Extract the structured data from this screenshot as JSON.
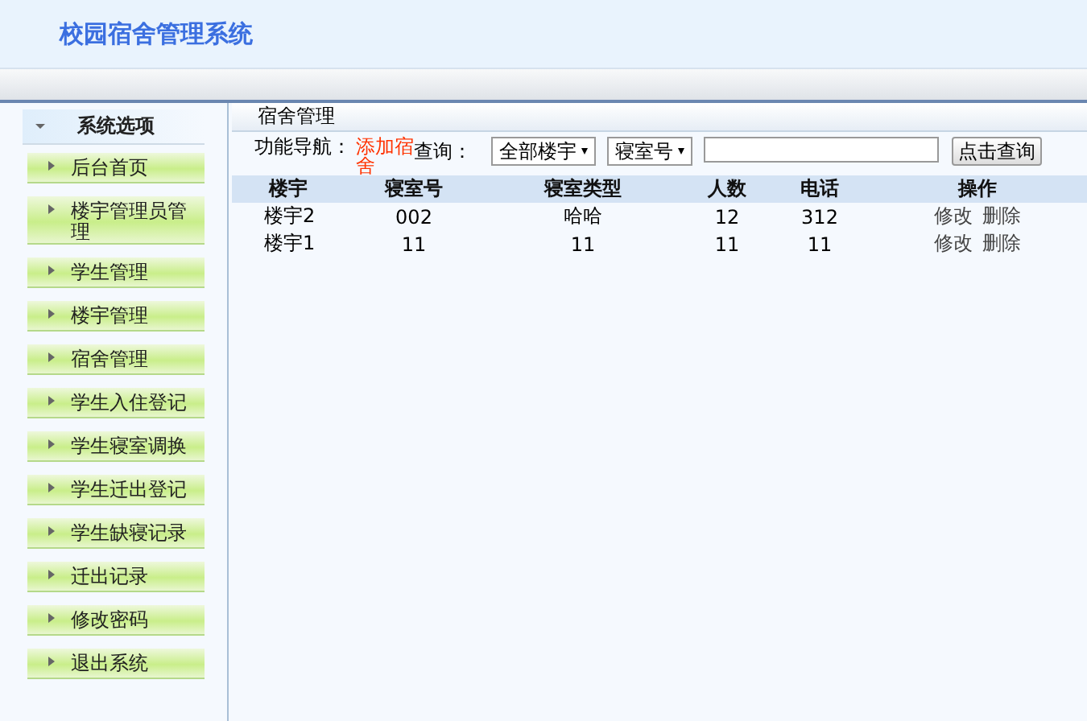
{
  "header": {
    "title": "校园宿舍管理系统"
  },
  "sidebar": {
    "title": "系统选项",
    "expanded": true,
    "items": [
      {
        "label": "后台首页"
      },
      {
        "label": "楼宇管理员管理"
      },
      {
        "label": "学生管理"
      },
      {
        "label": "楼宇管理"
      },
      {
        "label": "宿舍管理"
      },
      {
        "label": "学生入住登记"
      },
      {
        "label": "学生寝室调换"
      },
      {
        "label": "学生迁出登记"
      },
      {
        "label": "学生缺寝记录"
      },
      {
        "label": "迁出记录"
      },
      {
        "label": "修改密码"
      },
      {
        "label": "退出系统"
      }
    ]
  },
  "main": {
    "title": "宿舍管理",
    "nav_label": "功能导航：",
    "nav_link": "添加宿舍",
    "query_label": "查询：",
    "building_select": "全部楼宇",
    "field_select": "寝室号",
    "search_button": "点击查询",
    "table": {
      "columns": [
        "楼宇",
        "寝室号",
        "寝室类型",
        "人数",
        "电话",
        "操作"
      ],
      "rows": [
        {
          "cells": [
            "楼宇2",
            "002",
            "哈哈",
            "12",
            "312"
          ],
          "actions": [
            "修改",
            "删除"
          ]
        },
        {
          "cells": [
            "楼宇1",
            "11",
            "11",
            "11",
            "11"
          ],
          "actions": [
            "修改",
            "删除"
          ]
        }
      ]
    }
  }
}
